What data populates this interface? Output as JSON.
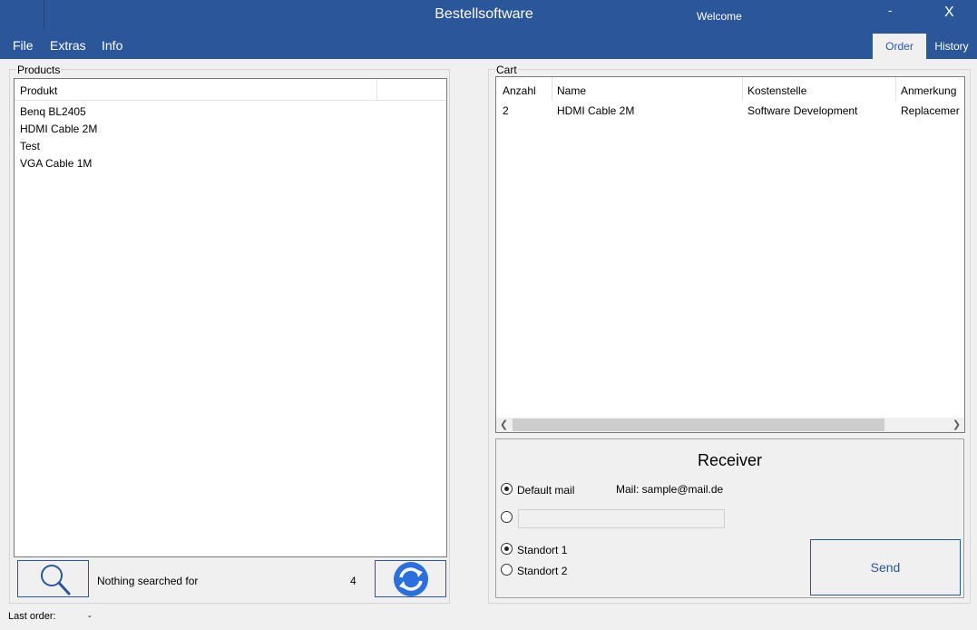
{
  "titlebar": {
    "title": "Bestellsoftware",
    "welcome": "Welcome",
    "minimize": "-",
    "close": "X"
  },
  "menu": {
    "file": "File",
    "extras": "Extras",
    "info": "Info"
  },
  "tabs": {
    "order": "Order",
    "history": "History",
    "active": "Order"
  },
  "products": {
    "group_label": "Products",
    "column_header": "Produkt",
    "items": [
      "Benq BL2405",
      "HDMI Cable 2M",
      "Test",
      "VGA Cable 1M"
    ],
    "search_status": "Nothing searched for",
    "count": "4",
    "search_icon": "magnifier-icon",
    "refresh_icon": "refresh-icon"
  },
  "cart": {
    "group_label": "Cart",
    "columns": [
      "Anzahl",
      "Name",
      "Kostenstelle",
      "Anmerkung"
    ],
    "rows": [
      [
        "2",
        "HDMI Cable 2M",
        "Software Development",
        "Replacemer"
      ]
    ]
  },
  "receiver": {
    "heading": "Receiver",
    "default_mail_label": "Default mail",
    "default_mail_value": "Mail: sample@mail.de",
    "custom_mail_value": "",
    "standort1": "Standort 1",
    "standort2": "Standort 2",
    "send": "Send",
    "selected_mail": "Default mail",
    "selected_location": "Standort 1"
  },
  "footer": {
    "last_order_label": "Last order:",
    "last_order_value": "-"
  },
  "colors": {
    "accent": "#2b579a",
    "window_bg": "#f0f0f0",
    "refresh_circle": "#2a6fdb"
  }
}
